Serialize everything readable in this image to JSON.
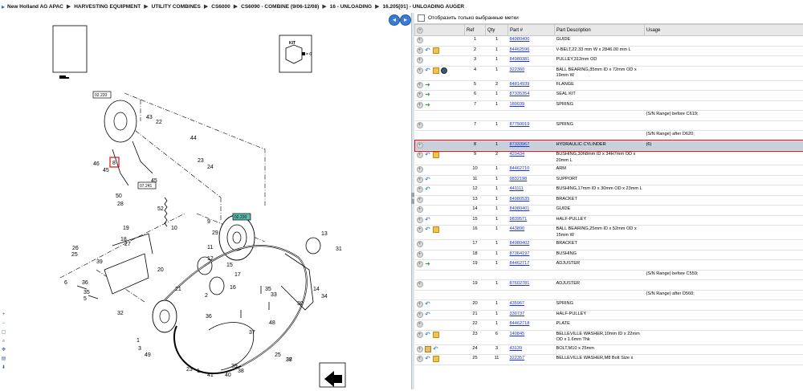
{
  "breadcrumb": [
    "New Holland AG APAC",
    "HARVESTING EQUIPMENT",
    "UTILITY COMBINES",
    "CS6000",
    "CS6090 - COMBINE (9/06-12/08)",
    "16 - UNLOADING",
    "16.205[01] - UNLOADING AUGER"
  ],
  "diagram": {
    "kit_label": "KIT",
    "kit_qty": "= 6",
    "callouts": [
      "02.220",
      "07.241",
      "02.220"
    ],
    "labels": [
      "43",
      "22",
      "44",
      "46",
      "23",
      "24",
      "45",
      "8",
      "45",
      "50",
      "28",
      "52",
      "10",
      "9",
      "19",
      "18",
      "29",
      "11",
      "12",
      "27",
      "26",
      "25",
      "39",
      "20",
      "21",
      "15",
      "17",
      "13",
      "31",
      "2",
      "16",
      "36",
      "35",
      "5",
      "6",
      "35",
      "33",
      "34",
      "30",
      "14",
      "32",
      "23",
      "1",
      "3",
      "49",
      "48",
      "38",
      "37",
      "36",
      "1",
      "41",
      "40",
      "39",
      "38",
      "25",
      "37"
    ]
  },
  "filter_label": "Отобразить только выбранные метки",
  "columns": [
    "",
    "Ref",
    "Qty",
    "Part #",
    "Part Description",
    "Usage"
  ],
  "rows": [
    {
      "icons": [
        "plus"
      ],
      "ref": "1",
      "qty": "1",
      "part": "84980400",
      "desc": "GUIDE",
      "usage": ""
    },
    {
      "icons": [
        "plus",
        "back",
        "box"
      ],
      "ref": "2",
      "qty": "1",
      "part": "84462596",
      "desc": "V-BELT,22.33 mm W x 2846.00 mm L",
      "usage": ""
    },
    {
      "icons": [
        "plus"
      ],
      "ref": "3",
      "qty": "1",
      "part": "84980381",
      "desc": "PULLEY,312mm OD",
      "usage": ""
    },
    {
      "icons": [
        "plus",
        "back",
        "box",
        "gear"
      ],
      "ref": "4",
      "qty": "1",
      "part": "322360",
      "desc": "BALL BEARING,35mm ID x 72mm OD x 19mm W",
      "usage": ""
    },
    {
      "icons": [
        "plus",
        "arrow"
      ],
      "ref": "5",
      "qty": "2",
      "part": "84814939",
      "desc": "FLANGE",
      "usage": ""
    },
    {
      "icons": [
        "plus",
        "arrow"
      ],
      "ref": "6",
      "qty": "1",
      "part": "87335354",
      "desc": "SEAL KIT",
      "usage": ""
    },
    {
      "icons": [
        "plus",
        "arrow"
      ],
      "ref": "7",
      "qty": "1",
      "part": "180039",
      "desc": "SPRING",
      "usage": ""
    },
    {
      "icons": [],
      "ref": "",
      "qty": "",
      "part": "",
      "desc": "",
      "usage": "(S/N Range) before C619;"
    },
    {
      "icons": [
        "plus"
      ],
      "ref": "7",
      "qty": "1",
      "part": "87750019",
      "desc": "SPRING",
      "usage": ""
    },
    {
      "icons": [],
      "ref": "",
      "qty": "",
      "part": "",
      "desc": "",
      "usage": "(S/N Range) after D620;"
    },
    {
      "icons": [
        "plus"
      ],
      "ref": "8",
      "qty": "1",
      "part": "87333967",
      "desc": "HYDRAULIC CYLINDER",
      "usage": "(6)",
      "selected": true
    },
    {
      "icons": [
        "plus",
        "back",
        "box"
      ],
      "ref": "9",
      "qty": "2",
      "part": "420434",
      "desc": "BUSHING,30h8mm ID x 34H7mm OD x 20mm L",
      "usage": ""
    },
    {
      "icons": [
        "plus"
      ],
      "ref": "10",
      "qty": "1",
      "part": "84462710",
      "desc": "ARM",
      "usage": ""
    },
    {
      "icons": [
        "plus",
        "back"
      ],
      "ref": "11",
      "qty": "1",
      "part": "9832198",
      "desc": "SUPPORT",
      "usage": ""
    },
    {
      "icons": [
        "plus",
        "back"
      ],
      "ref": "12",
      "qty": "1",
      "part": "441111",
      "desc": "BUSHING,17mm ID x 30mm OD x 23mm L",
      "usage": ""
    },
    {
      "icons": [
        "plus"
      ],
      "ref": "13",
      "qty": "1",
      "part": "84980535",
      "desc": "BRACKET",
      "usage": ""
    },
    {
      "icons": [
        "plus"
      ],
      "ref": "14",
      "qty": "1",
      "part": "84980401",
      "desc": "GUIDE",
      "usage": ""
    },
    {
      "icons": [
        "plus",
        "back"
      ],
      "ref": "15",
      "qty": "1",
      "part": "9839571",
      "desc": "HALF-PULLEY",
      "usage": ""
    },
    {
      "icons": [
        "plus",
        "back",
        "box"
      ],
      "ref": "16",
      "qty": "1",
      "part": "443890",
      "desc": "BALL BEARING,25mm ID x 52mm OD x 15mm W",
      "usage": ""
    },
    {
      "icons": [
        "plus"
      ],
      "ref": "17",
      "qty": "1",
      "part": "84980402",
      "desc": "BRACKET",
      "usage": ""
    },
    {
      "icons": [
        "plus"
      ],
      "ref": "18",
      "qty": "1",
      "part": "87364197",
      "desc": "BUSHING",
      "usage": ""
    },
    {
      "icons": [
        "plus",
        "arrow"
      ],
      "ref": "19",
      "qty": "1",
      "part": "84462717",
      "desc": "ADJUSTER",
      "usage": ""
    },
    {
      "icons": [],
      "ref": "",
      "qty": "",
      "part": "",
      "desc": "",
      "usage": "(S/N Range) before C559;"
    },
    {
      "icons": [
        "plus"
      ],
      "ref": "19",
      "qty": "1",
      "part": "87602781",
      "desc": "ADJUSTER",
      "usage": ""
    },
    {
      "icons": [],
      "ref": "",
      "qty": "",
      "part": "",
      "desc": "",
      "usage": "(S/N Range) after D560;"
    },
    {
      "icons": [
        "plus",
        "back"
      ],
      "ref": "20",
      "qty": "1",
      "part": "435967",
      "desc": "SPRING",
      "usage": ""
    },
    {
      "icons": [
        "plus",
        "back"
      ],
      "ref": "21",
      "qty": "1",
      "part": "330737",
      "desc": "HALF-PULLEY",
      "usage": ""
    },
    {
      "icons": [
        "plus"
      ],
      "ref": "22",
      "qty": "1",
      "part": "84462718",
      "desc": "PLATE",
      "usage": ""
    },
    {
      "icons": [
        "plus",
        "back",
        "box"
      ],
      "ref": "23",
      "qty": "6",
      "part": "140845",
      "desc": "BELLEVILLE WASHER,10mm ID x 22mm OD x 1.6mm Thk",
      "usage": ""
    },
    {
      "icons": [
        "plus",
        "doc",
        "back"
      ],
      "ref": "24",
      "qty": "3",
      "part": "43139",
      "desc": "BOLT,M10 x 25mm",
      "usage": ""
    },
    {
      "icons": [
        "plus",
        "back",
        "box"
      ],
      "ref": "25",
      "qty": "11",
      "part": "322357",
      "desc": "BELLEVILLE WASHER,M8 Bolt Size x",
      "usage": ""
    }
  ]
}
